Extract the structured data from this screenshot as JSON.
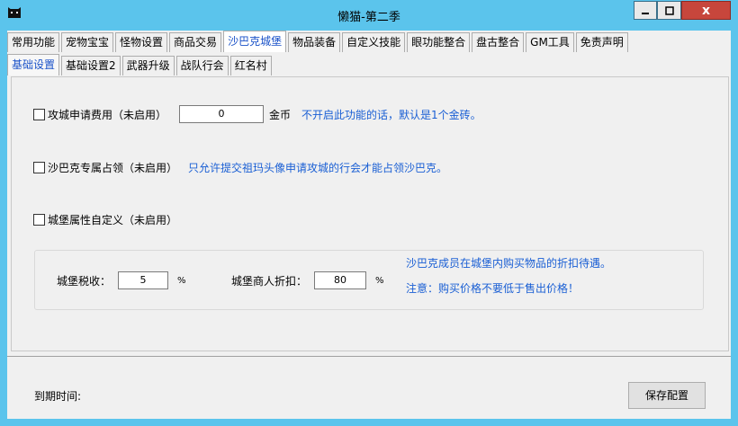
{
  "window": {
    "title": "懒猫-第二季",
    "buttons": {
      "minimize": "—",
      "maximize": "□",
      "close": "x"
    }
  },
  "tabs_main": [
    {
      "label": "常用功能"
    },
    {
      "label": "宠物宝宝"
    },
    {
      "label": "怪物设置"
    },
    {
      "label": "商品交易"
    },
    {
      "label": "沙巴克城堡",
      "active": true
    },
    {
      "label": "物品装备"
    },
    {
      "label": "自定义技能"
    },
    {
      "label": "眼功能整合"
    },
    {
      "label": "盘古整合"
    },
    {
      "label": "GM工具"
    },
    {
      "label": "免责声明"
    }
  ],
  "tabs_sub": [
    {
      "label": "基础设置",
      "active": true
    },
    {
      "label": "基础设置2"
    },
    {
      "label": "武器升级"
    },
    {
      "label": "战队行会"
    },
    {
      "label": "红名村"
    }
  ],
  "settings": {
    "siege_fee": {
      "label": "攻城申请费用（未启用）",
      "value": "0",
      "unit": "金币",
      "hint": "不开启此功能的话，默认是1个金砖。"
    },
    "sbk_exclusive": {
      "label": "沙巴克专属占领（未启用）",
      "hint": "只允许提交祖玛头像申请攻城的行会才能占领沙巴克。"
    },
    "castle_attr": {
      "label": "城堡属性自定义（未启用）"
    },
    "tax": {
      "label": "城堡税收：",
      "value": "5",
      "unit": "%"
    },
    "discount": {
      "label": "城堡商人折扣：",
      "value": "80",
      "unit": "%"
    },
    "discount_hint1": "沙巴克成员在城堡内购买物品的折扣待遇。",
    "discount_hint2": "注意：购买价格不要低于售出价格！"
  },
  "footer": {
    "expire_label": "到期时间:",
    "save_label": "保存配置"
  },
  "colors": {
    "titlebar": "#5bc4ec",
    "hint_blue": "#1a5fd4",
    "close_red": "#c7463c"
  }
}
